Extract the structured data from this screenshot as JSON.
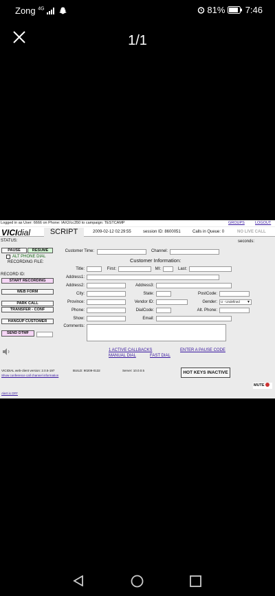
{
  "statusbar": {
    "carrier": "Zong",
    "network": "4G",
    "battery": "81%",
    "time": "7:46"
  },
  "viewer": {
    "counter": "1/1"
  },
  "vicidial": {
    "login_line": "Logged in as User: 6666 on Phone: IAX2/cc350 to campaign: TESTCAMP",
    "links": {
      "groups": "GROUPS",
      "logout": "LOGOUT"
    },
    "logo": {
      "vici": "VICI",
      "dial": "dial"
    },
    "tab_script": "SCRIPT",
    "datetime": "2009-02-12 02:29:55",
    "session": "session ID: 8600051",
    "queue": "Calls in Queue: 0",
    "no_live": "NO LIVE CALL",
    "status_label": "STATUS:",
    "seconds_label": "seconds:",
    "buttons": {
      "pause": "PAUSE",
      "resume": "RESUME",
      "start_recording": "START RECORDING",
      "web_form": "WEB FORM",
      "park_call": "PARK CALL",
      "transfer": "TRANSFER - CONF",
      "hangup": "HANGUP CUSTOMER",
      "send_dtmf": "SEND DTMF"
    },
    "alt_phone_dial": "ALT PHONE DIAL",
    "recording_file": "RECORDING FILE:",
    "record_id": "RECORD ID:",
    "customer_time": "Customer Time:",
    "channel": "Channel:",
    "customer_info": "Customer Information:",
    "fields": {
      "title": "Title:",
      "first": "First:",
      "mi": "MI:",
      "last": "Last:",
      "address1": "Address1:",
      "address2": "Address2:",
      "address3": "Address3:",
      "city": "City:",
      "state": "State:",
      "postcode": "PostCode:",
      "province": "Province:",
      "vendor_id": "Vendor ID:",
      "gender": "Gender:",
      "phone": "Phone:",
      "dialcode": "DialCode:",
      "alt_phone": "Alt. Phone:",
      "show": "Show:",
      "email": "Email:",
      "comments": "Comments:"
    },
    "gender_value": "U - Undefined",
    "callbacks": "1 ACTIVE CALLBACKS",
    "manual_dial": "MANUAL DIAL",
    "fast_dial": "FAST DIAL",
    "pause_code": "ENTER A PAUSE CODE",
    "version": "VICIDIAL web-client version: 2.0.5-197",
    "build": "BUILD: 90209-0132",
    "server": "Server: 10.0.0.5",
    "conf_info": "Show conference call channel information",
    "alert": "Alert is OFF",
    "hot_keys": "HOT KEYS INACTIVE",
    "mute": "MUTE"
  }
}
